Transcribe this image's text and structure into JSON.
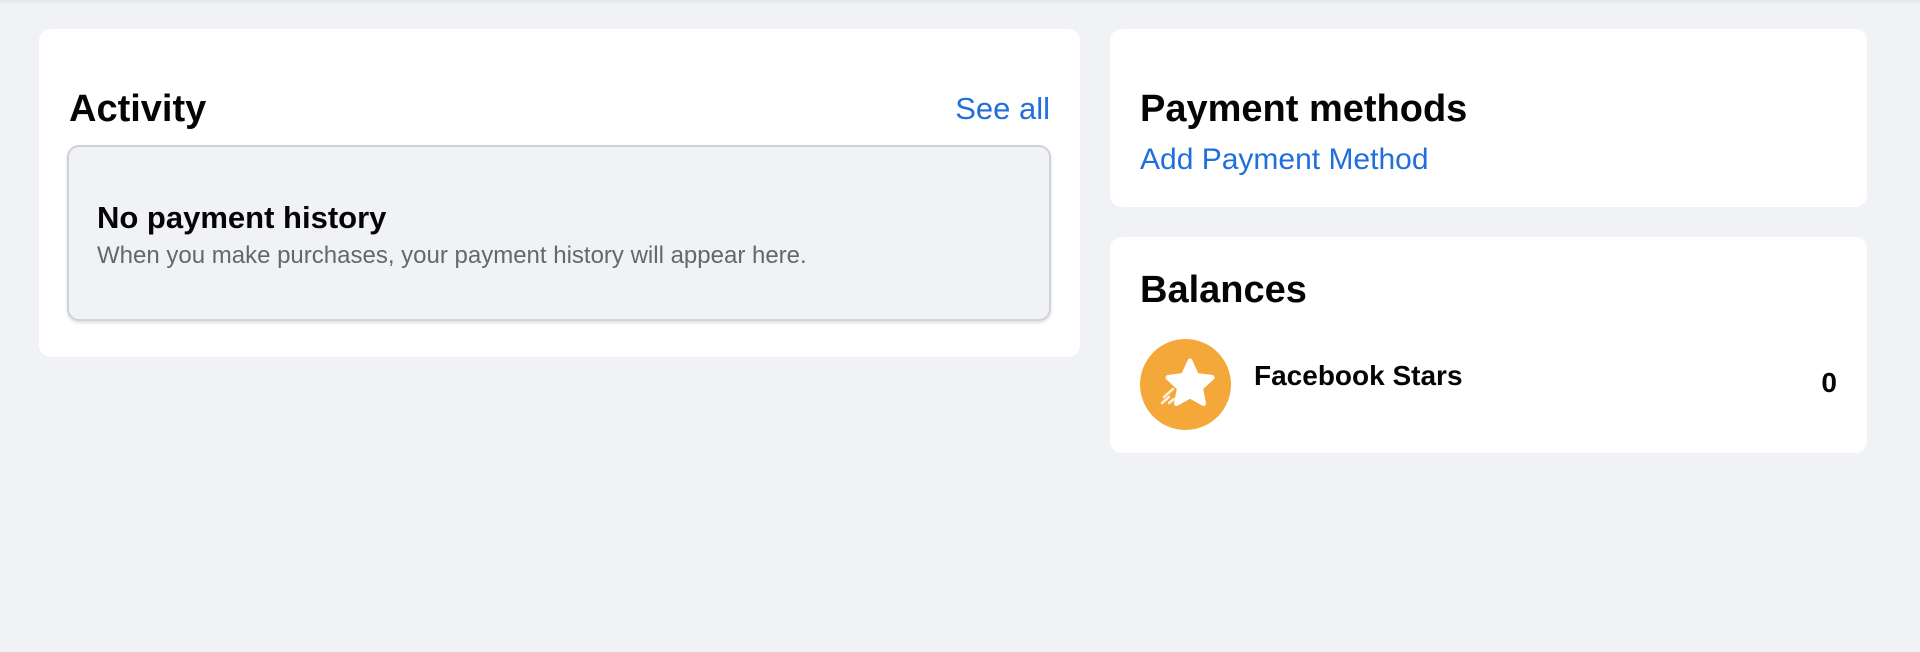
{
  "activity": {
    "title": "Activity",
    "see_all_label": "See all",
    "empty_state": {
      "title": "No payment history",
      "text": "When you make purchases, your payment history will appear here."
    }
  },
  "payment_methods": {
    "title": "Payment methods",
    "add_label": "Add Payment Method"
  },
  "balances": {
    "title": "Balances",
    "items": [
      {
        "icon": "star-icon",
        "name": "Facebook Stars",
        "value": "0"
      }
    ]
  },
  "colors": {
    "page_background": "#f0f2f5",
    "link": "#216fdb",
    "stars_accent": "#f4a83a",
    "secondary_text": "#65676b"
  }
}
